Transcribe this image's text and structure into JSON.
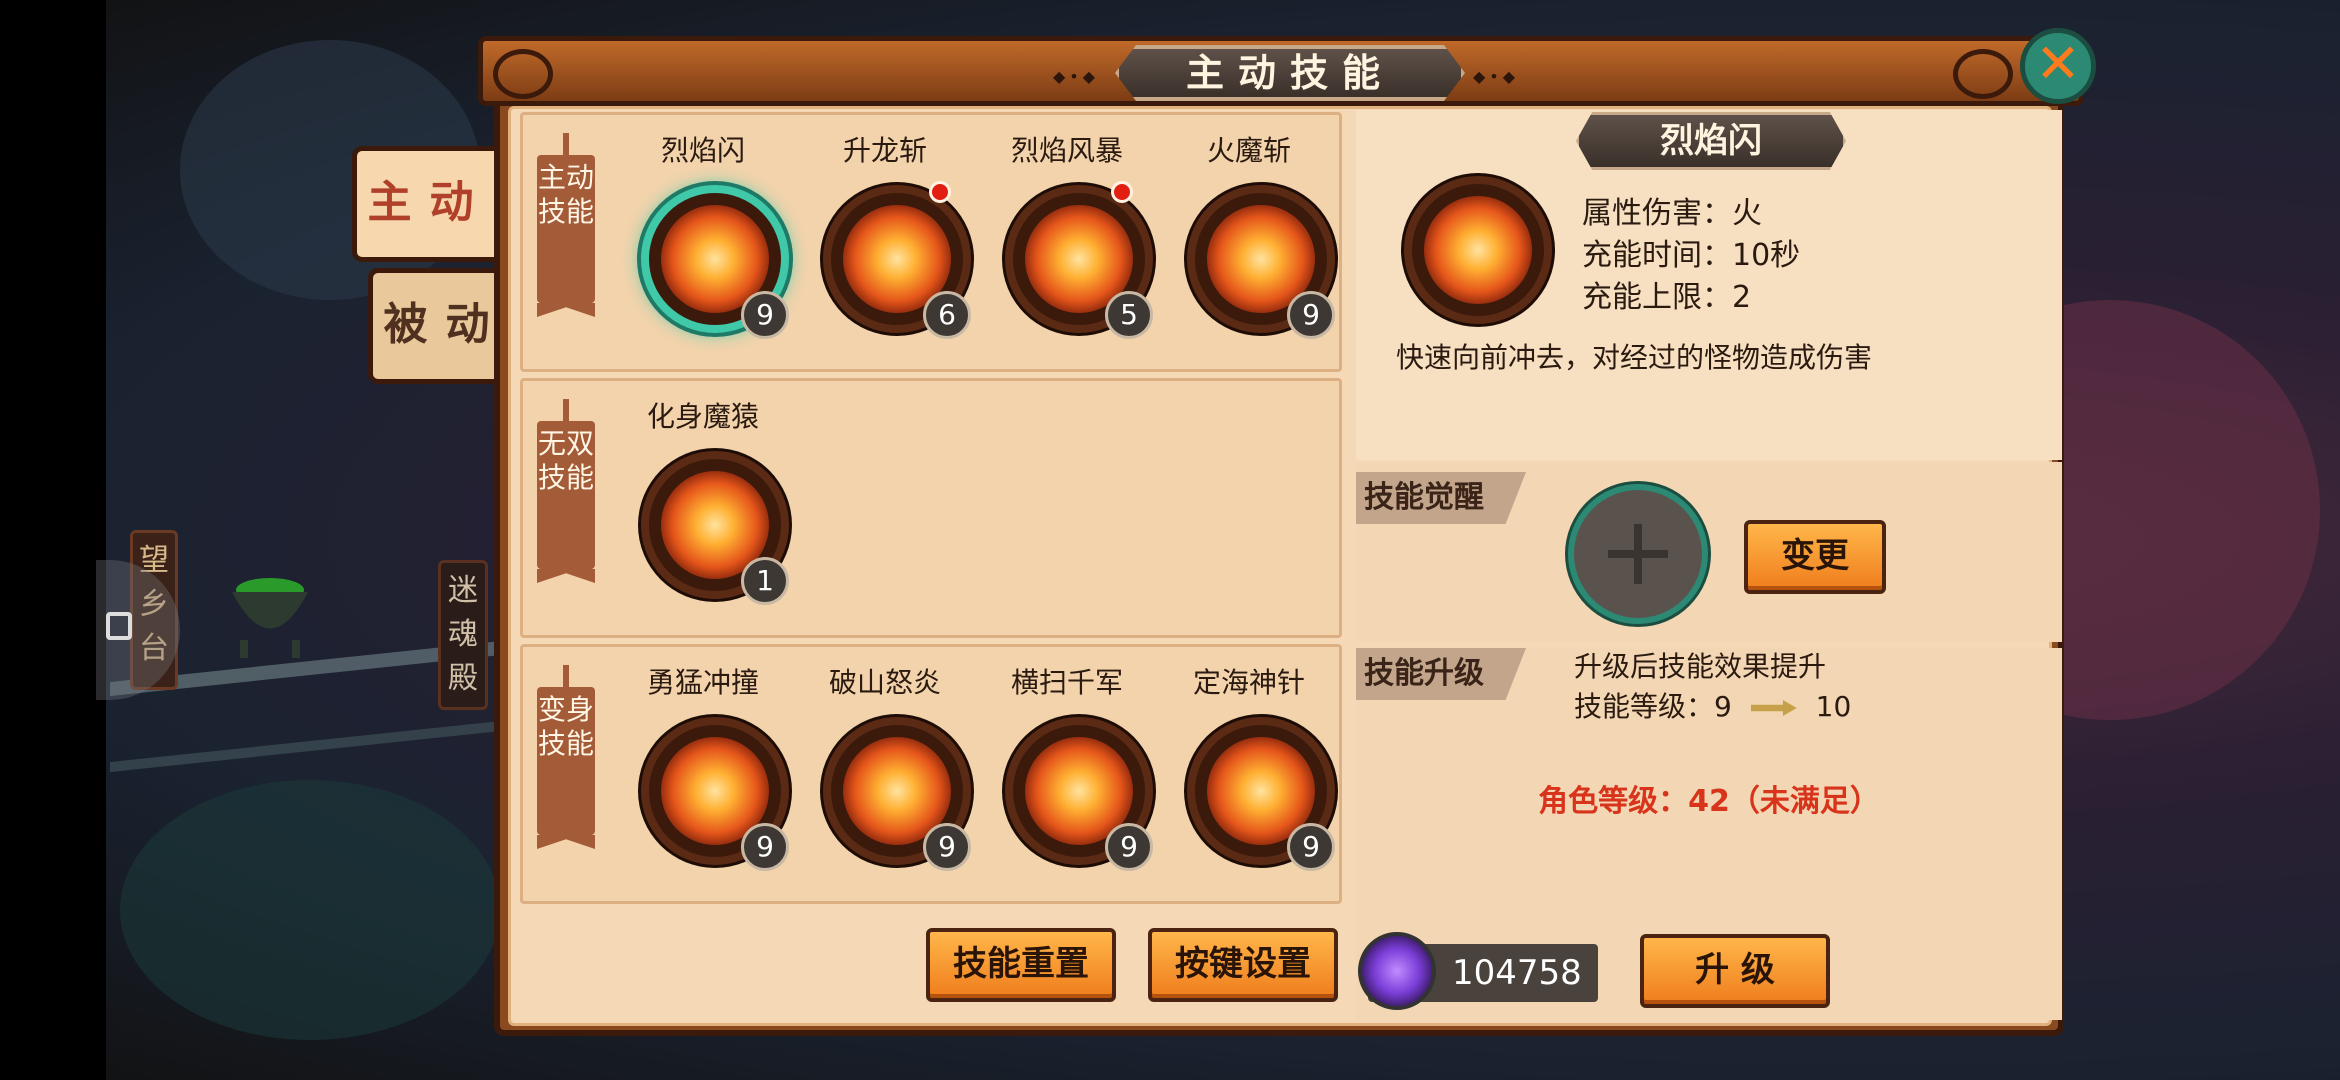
{
  "map": {
    "sign_left": "望乡台",
    "sign_right": "迷魂殿"
  },
  "panel": {
    "title": "主动技能",
    "close_icon": "close-icon",
    "colors": {
      "accent": "#ef7d1c",
      "panel_bg": "#f5d9b6",
      "frame": "#8a4a20",
      "teal": "#3fc9a8",
      "warning": "#d8341c"
    }
  },
  "side_tabs": [
    {
      "label": "主动",
      "active": true
    },
    {
      "label": "被动",
      "active": false
    }
  ],
  "groups": {
    "active": {
      "label": "主动技能",
      "skills": [
        {
          "name": "烈焰闪",
          "level": "9",
          "selected": true,
          "red_dot": false
        },
        {
          "name": "升龙斩",
          "level": "6",
          "selected": false,
          "red_dot": true
        },
        {
          "name": "烈焰风暴",
          "level": "5",
          "selected": false,
          "red_dot": true
        },
        {
          "name": "火魔斩",
          "level": "9",
          "selected": false,
          "red_dot": false
        }
      ]
    },
    "unrivaled": {
      "label": "无双技能",
      "skills": [
        {
          "name": "化身魔猿",
          "level": "1"
        }
      ]
    },
    "transform": {
      "label": "变身技能",
      "skills": [
        {
          "name": "勇猛冲撞",
          "level": "9"
        },
        {
          "name": "破山怒炎",
          "level": "9"
        },
        {
          "name": "横扫千军",
          "level": "9"
        },
        {
          "name": "定海神针",
          "level": "9"
        }
      ]
    }
  },
  "buttons": {
    "reset": "技能重置",
    "keybind": "按键设置",
    "change": "变更",
    "upgrade": "升 级"
  },
  "detail": {
    "skill_name": "烈焰闪",
    "attr_damage": "属性伤害：火",
    "attr_charge_time": "充能时间：10秒",
    "attr_charge_limit": "充能上限：2",
    "description": "快速向前冲去，对经过的怪物造成伤害",
    "awaken_title": "技能觉醒",
    "upgrade_title": "技能升级",
    "upgrade_effect": "升级后技能效果提升",
    "level_label": "技能等级：9",
    "level_next": "10",
    "requirement": "角色等级：42（未满足）"
  },
  "currency": {
    "amount": "104758",
    "icon": "spirit-orb-icon"
  }
}
